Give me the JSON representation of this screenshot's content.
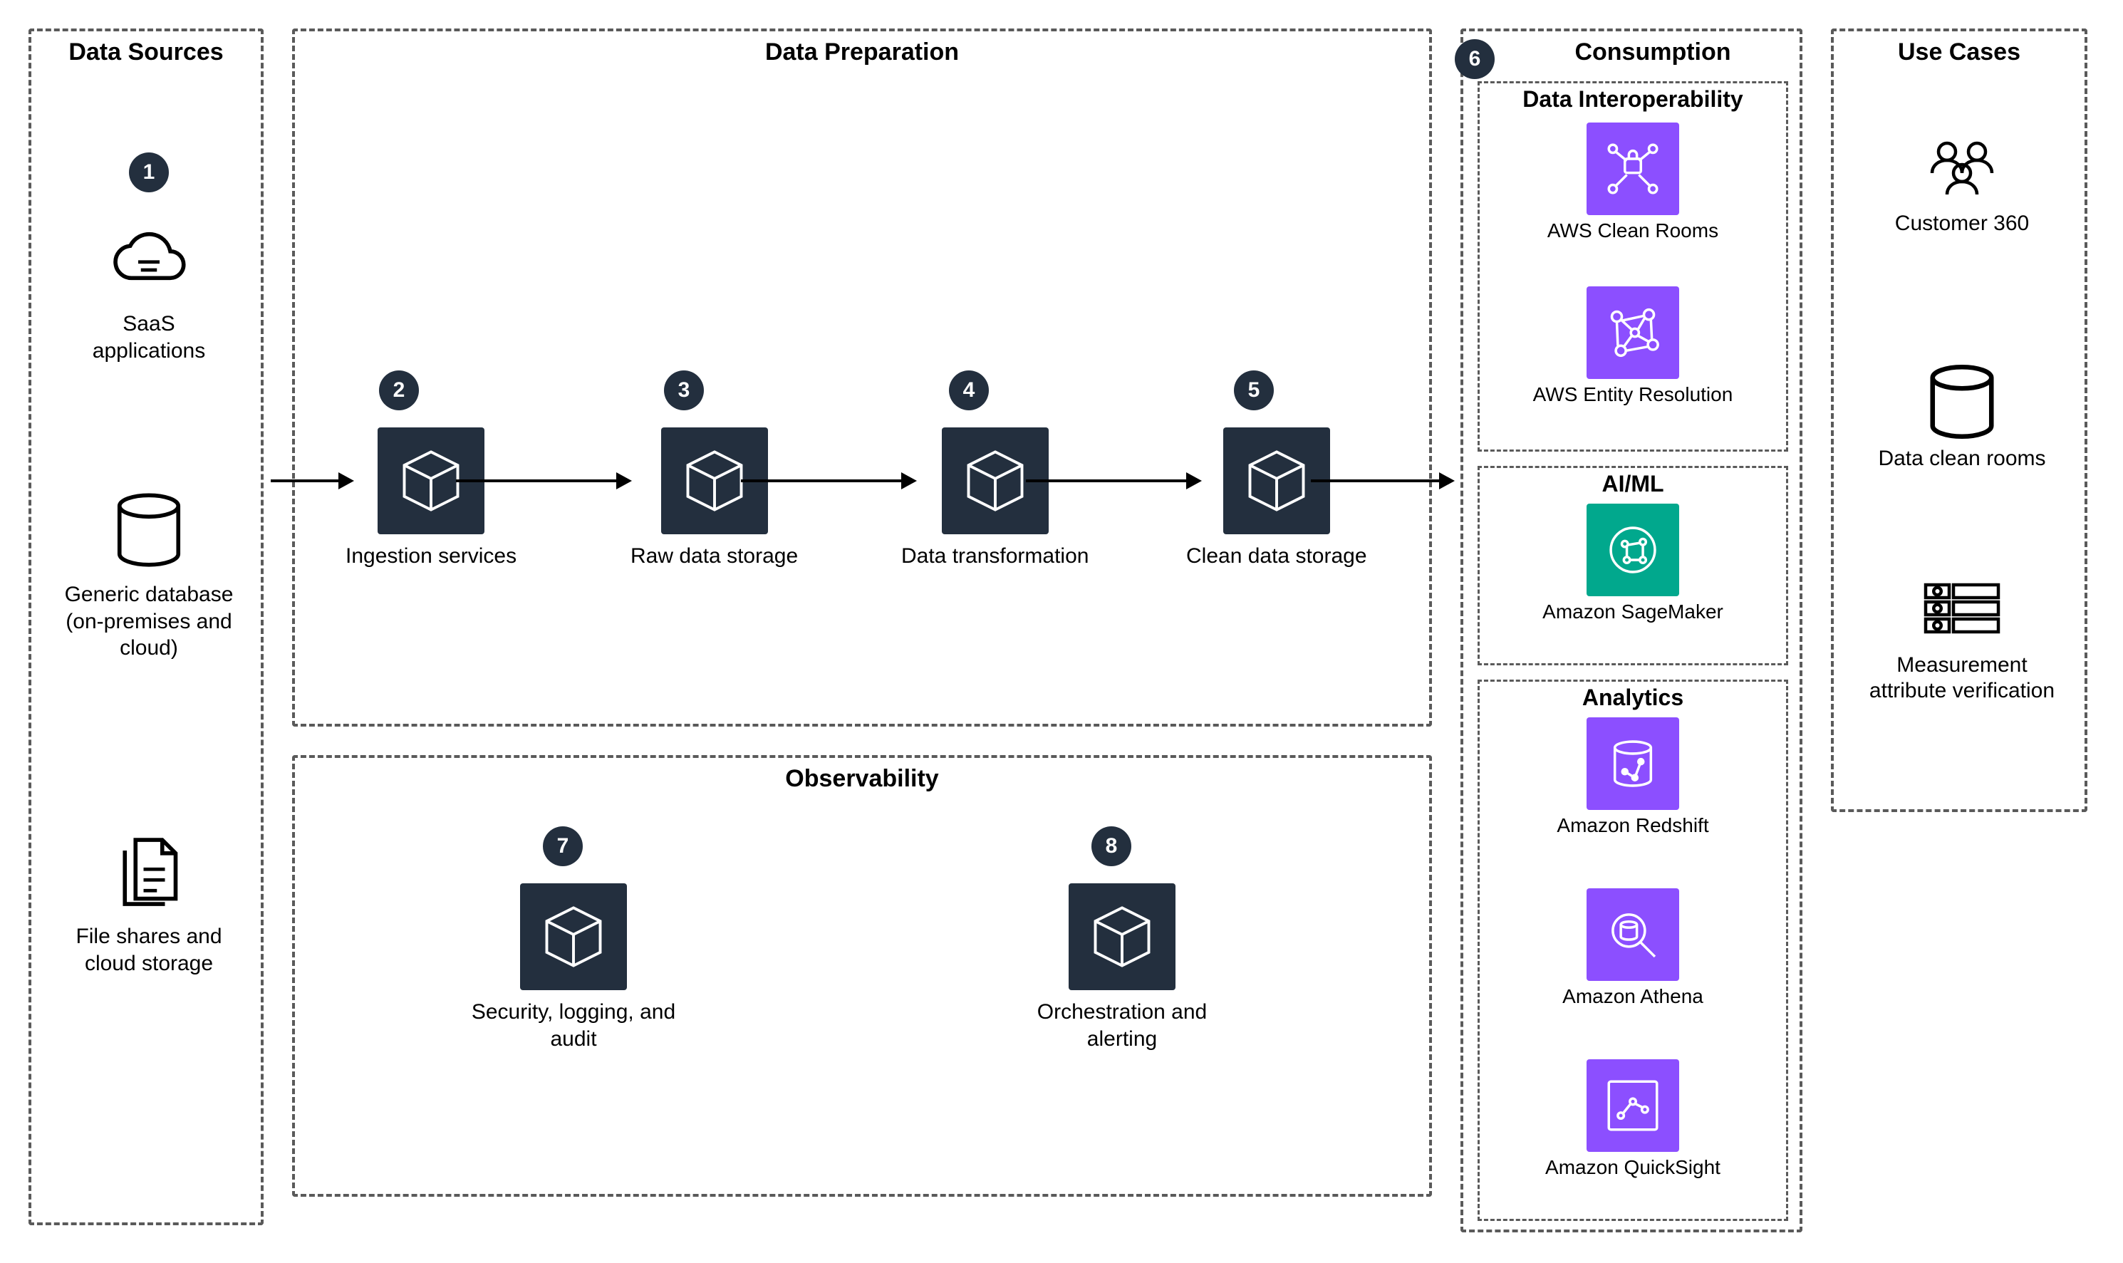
{
  "groups": {
    "data_sources": {
      "title": "Data Sources"
    },
    "data_prep": {
      "title": "Data Preparation"
    },
    "observability": {
      "title": "Observability"
    },
    "consumption": {
      "title": "Consumption"
    },
    "use_cases": {
      "title": "Use Cases"
    }
  },
  "sub_groups": {
    "interop": {
      "title": "Data Interoperability"
    },
    "aiml": {
      "title": "AI/ML"
    },
    "analytics": {
      "title": "Analytics"
    }
  },
  "badges": {
    "b1": "1",
    "b2": "2",
    "b3": "3",
    "b4": "4",
    "b5": "5",
    "b6": "6",
    "b7": "7",
    "b8": "8"
  },
  "data_sources": {
    "saas": "SaaS applications",
    "db": "Generic database (on-premises and cloud)",
    "files": "File shares and cloud storage"
  },
  "prep": {
    "ingest": "Ingestion services",
    "raw": "Raw data storage",
    "transform": "Data transformation",
    "clean": "Clean data storage"
  },
  "obs": {
    "sec": "Security, logging, and audit",
    "orch": "Orchestration and alerting"
  },
  "consumption": {
    "clean_rooms": "AWS Clean Rooms",
    "entity_res": "AWS Entity Resolution",
    "sagemaker": "Amazon SageMaker",
    "redshift": "Amazon Redshift",
    "athena": "Amazon Athena",
    "quicksight": "Amazon QuickSight"
  },
  "use_cases": {
    "c360": "Customer 360",
    "dcr": "Data clean rooms",
    "mav": "Measurement attribute verification"
  }
}
